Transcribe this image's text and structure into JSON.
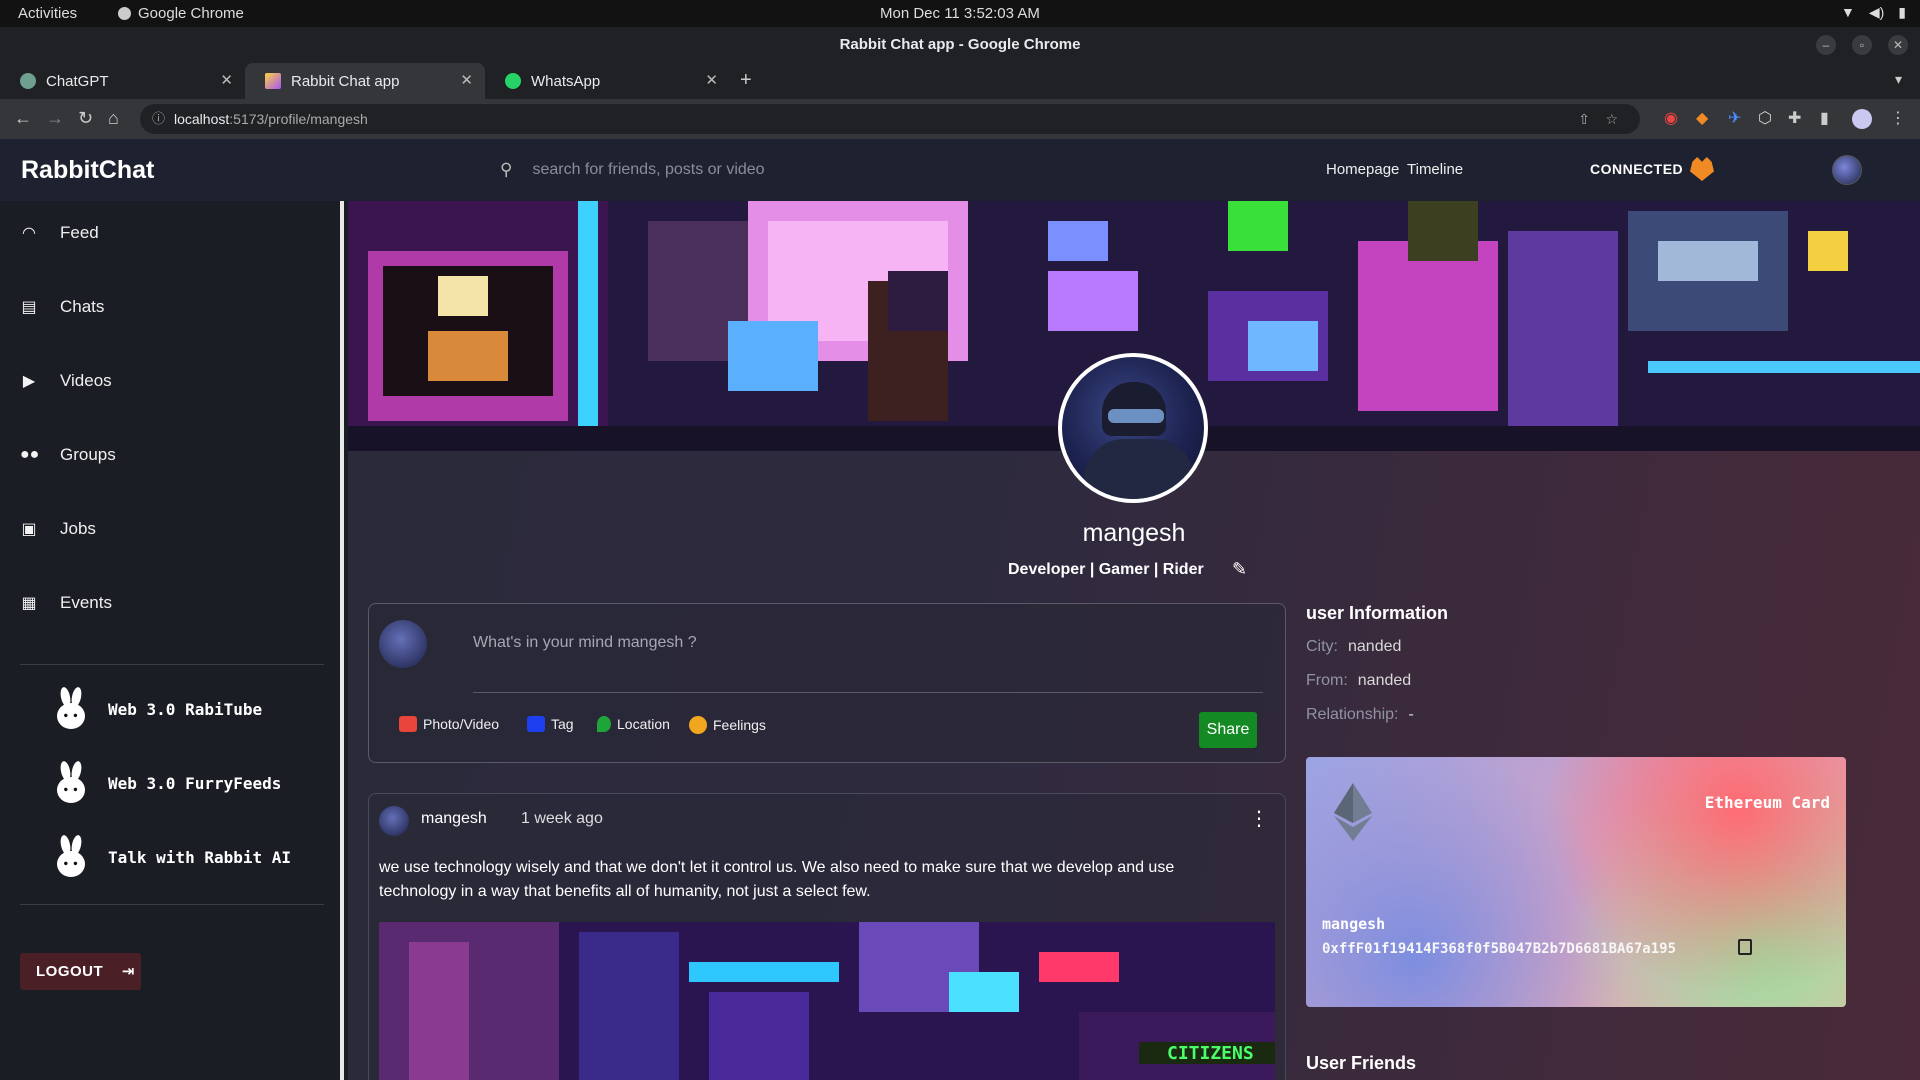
{
  "os": {
    "activities": "Activities",
    "app_name": "Google Chrome",
    "clock": "Mon Dec 11  3:52:03 AM"
  },
  "browser": {
    "window_title": "Rabbit Chat app - Google Chrome",
    "tabs": [
      {
        "label": "ChatGPT",
        "active": false
      },
      {
        "label": "Rabbit Chat app",
        "active": true
      },
      {
        "label": "WhatsApp",
        "active": false
      }
    ],
    "url_host": "localhost",
    "url_path": ":5173/profile/mangesh"
  },
  "header": {
    "logo": "RabbitChat",
    "search_placeholder": "search for friends, posts or video",
    "links": [
      "Homepage",
      "Timeline"
    ],
    "status": "CONNECTED"
  },
  "sidebar": {
    "items": [
      {
        "label": "Feed",
        "icon": "rss-icon"
      },
      {
        "label": "Chats",
        "icon": "chat-icon"
      },
      {
        "label": "Videos",
        "icon": "video-icon"
      },
      {
        "label": "Groups",
        "icon": "group-icon"
      },
      {
        "label": "Jobs",
        "icon": "briefcase-icon"
      },
      {
        "label": "Events",
        "icon": "calendar-icon"
      }
    ],
    "external": [
      {
        "label": "Web 3.0 RabiTube"
      },
      {
        "label": "Web 3.0 FurryFeeds"
      },
      {
        "label": "Talk with Rabbit AI"
      }
    ],
    "logout_label": "LOGOUT"
  },
  "profile": {
    "name": "mangesh",
    "bio": "Developer | Gamer | Rider"
  },
  "composer": {
    "placeholder": "What's in your mind mangesh ?",
    "options": [
      {
        "label": "Photo/Video",
        "color": "#e8453c"
      },
      {
        "label": "Tag",
        "color": "#1e3ff0"
      },
      {
        "label": "Location",
        "color": "#1ea53a"
      },
      {
        "label": "Feelings",
        "color": "#f0a61e"
      }
    ],
    "share_label": "Share"
  },
  "post": {
    "author": "mangesh",
    "time": "1 week ago",
    "text": "we use technology wisely and that we don't let it control us. We also need to make sure that we develop and use technology in a way that benefits all of humanity, not just a select few."
  },
  "user_info": {
    "title": "user Information",
    "rows": [
      {
        "key": "City:",
        "value": "nanded"
      },
      {
        "key": "From:",
        "value": "nanded"
      },
      {
        "key": "Relationship:",
        "value": "-"
      }
    ]
  },
  "eth_card": {
    "title": "Ethereum Card",
    "name": "mangesh",
    "address": "0xffF01f19414F368f0f5B047B2b7D6681BA67a195"
  },
  "friends_title": "User Friends"
}
